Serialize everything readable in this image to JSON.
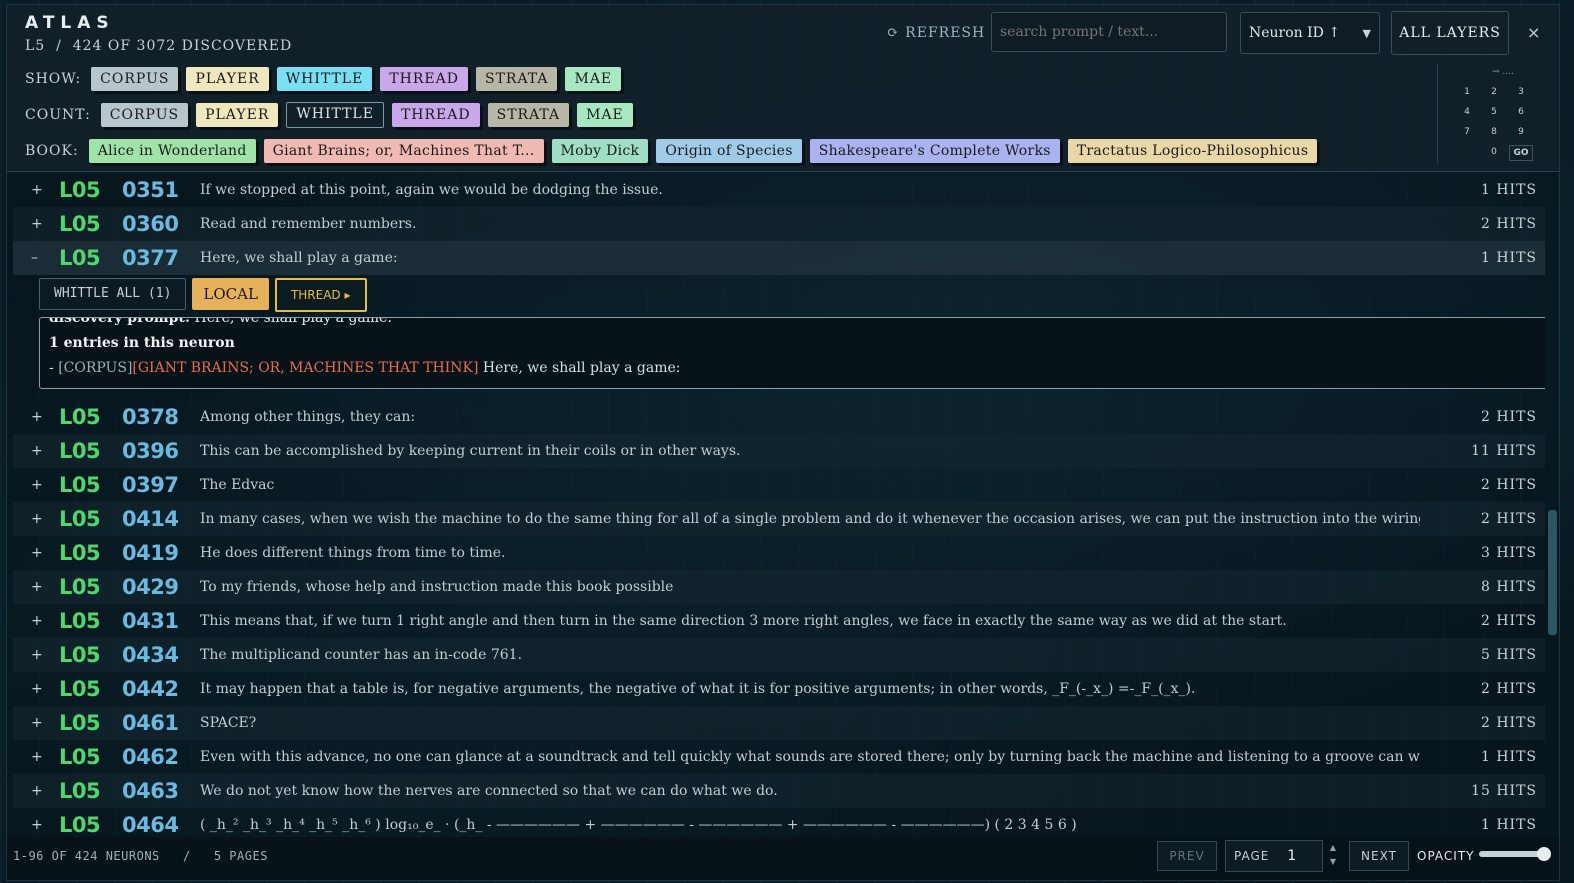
{
  "colors": {
    "corpus": "#b7c6cc",
    "player": "#efe7bd",
    "whittle": "#79dff2",
    "thread": "#c9a7ea",
    "strata": "#b8b6a4",
    "mae": "#a8e8c0",
    "layer_id": "#4cd86a",
    "neuron_id": "#6ab9df",
    "book_highlight": "#ea6b4b"
  },
  "header": {
    "logo": "ATLAS",
    "subtitle": "L5  /  424 OF 3072 DISCOVERED",
    "refresh_icon": "refresh-icon",
    "refresh_label": "⟳ REFRESH",
    "search_placeholder": "search prompt / text...",
    "sort_value": "Neuron ID ↑",
    "all_layers_label": "ALL LAYERS",
    "close_label": "×"
  },
  "filters": {
    "show_label": "SHOW:",
    "show": [
      "CORPUS",
      "PLAYER",
      "WHITTLE",
      "THREAD",
      "STRATA",
      "MAE"
    ],
    "count_label": "COUNT:",
    "count": [
      "CORPUS",
      "PLAYER",
      "WHITTLE",
      "THREAD",
      "STRATA",
      "MAE"
    ],
    "book_label": "BOOK:",
    "books": [
      {
        "label": "Alice in Wonderland",
        "color": "#9fe3a8"
      },
      {
        "label": "Giant Brains; or, Machines That T...",
        "color": "#f0b9b2"
      },
      {
        "label": "Moby Dick",
        "color": "#9fe0c4"
      },
      {
        "label": "Origin of Species",
        "color": "#9fcae8"
      },
      {
        "label": "Shakespeare's Complete Works",
        "color": "#aab3ef"
      },
      {
        "label": "Tractatus Logico-Philosophicus",
        "color": "#ead7a8"
      }
    ]
  },
  "keypad": {
    "arrow": "→ ....",
    "keys": [
      "1",
      "2",
      "3",
      "4",
      "5",
      "6",
      "7",
      "8",
      "9",
      "0"
    ],
    "go": "GO"
  },
  "rows": [
    {
      "toggle": "+",
      "layer": "L05",
      "id": "0351",
      "text": "If we stopped at this point, again we would be dodging the issue.",
      "hits": "1 HITS"
    },
    {
      "toggle": "+",
      "layer": "L05",
      "id": "0360",
      "text": "Read and remember numbers.",
      "hits": "2 HITS"
    },
    {
      "toggle": "–",
      "layer": "L05",
      "id": "0377",
      "text": "Here, we shall play a game:",
      "hits": "1 HITS"
    },
    {
      "toggle": "+",
      "layer": "L05",
      "id": "0378",
      "text": "Among other things, they can:",
      "hits": "2 HITS"
    },
    {
      "toggle": "+",
      "layer": "L05",
      "id": "0396",
      "text": "This can be accomplished by keeping current in their coils or in other ways.",
      "hits": "11 HITS"
    },
    {
      "toggle": "+",
      "layer": "L05",
      "id": "0397",
      "text": "The Edvac",
      "hits": "2 HITS"
    },
    {
      "toggle": "+",
      "layer": "L05",
      "id": "0414",
      "text": "In many cases, when we wish the machine to do the same thing for all of a single problem and do it whenever the occasion arises, we can put the instruction into the wiring of a plu",
      "hits": "2 HITS"
    },
    {
      "toggle": "+",
      "layer": "L05",
      "id": "0419",
      "text": "He does different things from time to time.",
      "hits": "3 HITS"
    },
    {
      "toggle": "+",
      "layer": "L05",
      "id": "0429",
      "text": "To my friends, whose help and instruction made this book possible",
      "hits": "8 HITS"
    },
    {
      "toggle": "+",
      "layer": "L05",
      "id": "0431",
      "text": "This means that, if we turn 1 right angle and then turn in the same direction 3 more right angles, we face in exactly the same way as we did at the start.",
      "hits": "2 HITS"
    },
    {
      "toggle": "+",
      "layer": "L05",
      "id": "0434",
      "text": "The multiplicand counter has an in-code 761.",
      "hits": "5 HITS"
    },
    {
      "toggle": "+",
      "layer": "L05",
      "id": "0442",
      "text": "It may happen that a table is, for negative arguments, the negative of what it is for positive arguments; in other words, _F_(-_x_) =-_F_(_x_).",
      "hits": "2 HITS"
    },
    {
      "toggle": "+",
      "layer": "L05",
      "id": "0461",
      "text": "SPACE?",
      "hits": "2 HITS"
    },
    {
      "toggle": "+",
      "layer": "L05",
      "id": "0462",
      "text": "Even with this advance, no one can glance at a soundtrack and tell quickly what sounds are stored there; only by turning back the machine and listening to a groove can we determine",
      "hits": "1 HITS"
    },
    {
      "toggle": "+",
      "layer": "L05",
      "id": "0463",
      "text": "We do not yet know how the nerves are connected so that we can do what we do.",
      "hits": "15 HITS"
    },
    {
      "toggle": "+",
      "layer": "L05",
      "id": "0464",
      "text": "( _h_² _h_³ _h_⁴ _h_⁵ _h_⁶ ) log₁₀_e_ · (_h_ - —————— + —————— - —————— + —————— - ——————) ( 2 3 4 5 6 )",
      "hits": "1 HITS"
    }
  ],
  "expanded": {
    "whittle_all": "WHITTLE ALL (1)",
    "local": "LOCAL",
    "thread": "THREAD ▸",
    "prompt_label": "discovery prompt:",
    "prompt_text": "Here, we shall play a game:",
    "entries": "1 entries in this neuron",
    "entry_prefix": "- ",
    "entry_corpus": "[CORPUS]",
    "entry_book": "[GIANT BRAINS; OR, MACHINES THAT THINK]",
    "entry_text": " Here, we shall play a game:"
  },
  "footer": {
    "count": "1-96 OF 424 NEURONS   /   5 PAGES",
    "prev": "PREV",
    "page_label": "PAGE",
    "page_value": "1",
    "next": "NEXT",
    "opacity_label": "OPACITY",
    "opacity_value": 1.0
  }
}
